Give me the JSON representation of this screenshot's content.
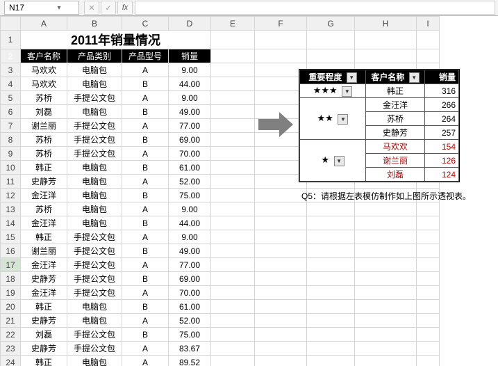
{
  "formula_bar": {
    "name_box": "N17",
    "cancel": "✕",
    "enter": "✓",
    "fx": "fx",
    "value": ""
  },
  "columns": [
    "A",
    "B",
    "C",
    "D",
    "E",
    "F",
    "G",
    "H",
    "I"
  ],
  "title": "2011年销量情况",
  "headers": [
    "客户名称",
    "产品类别",
    "产品型号",
    "销量"
  ],
  "rows": [
    [
      "马欢欢",
      "电脑包",
      "A",
      "9.00"
    ],
    [
      "马欢欢",
      "电脑包",
      "B",
      "44.00"
    ],
    [
      "苏桥",
      "手提公文包",
      "A",
      "9.00"
    ],
    [
      "刘磊",
      "电脑包",
      "B",
      "49.00"
    ],
    [
      "谢兰丽",
      "手提公文包",
      "A",
      "77.00"
    ],
    [
      "苏桥",
      "手提公文包",
      "B",
      "69.00"
    ],
    [
      "苏桥",
      "手提公文包",
      "A",
      "70.00"
    ],
    [
      "韩正",
      "电脑包",
      "B",
      "61.00"
    ],
    [
      "史静芳",
      "电脑包",
      "A",
      "52.00"
    ],
    [
      "金汪洋",
      "电脑包",
      "B",
      "75.00"
    ],
    [
      "苏桥",
      "电脑包",
      "A",
      "9.00"
    ],
    [
      "金汪洋",
      "电脑包",
      "B",
      "44.00"
    ],
    [
      "韩正",
      "手提公文包",
      "A",
      "9.00"
    ],
    [
      "谢兰丽",
      "手提公文包",
      "B",
      "49.00"
    ],
    [
      "金汪洋",
      "手提公文包",
      "A",
      "77.00"
    ],
    [
      "史静芳",
      "手提公文包",
      "B",
      "69.00"
    ],
    [
      "金汪洋",
      "手提公文包",
      "A",
      "70.00"
    ],
    [
      "韩正",
      "电脑包",
      "B",
      "61.00"
    ],
    [
      "史静芳",
      "电脑包",
      "A",
      "52.00"
    ],
    [
      "刘磊",
      "手提公文包",
      "B",
      "75.00"
    ],
    [
      "史静芳",
      "手提公文包",
      "A",
      "83.67"
    ],
    [
      "韩正",
      "电脑包",
      "A",
      "89.52"
    ]
  ],
  "pivot": {
    "headers": [
      "重要程度",
      "客户名称",
      "销量"
    ],
    "groups": [
      {
        "label": "★★★",
        "rows": [
          [
            "韩正",
            "316"
          ]
        ]
      },
      {
        "label": "★★",
        "rows": [
          [
            "金汪洋",
            "266"
          ],
          [
            "苏桥",
            "264"
          ],
          [
            "史静芳",
            "257"
          ]
        ]
      },
      {
        "label": "★",
        "rows": [
          [
            "马欢欢",
            "154"
          ],
          [
            "谢兰丽",
            "126"
          ],
          [
            "刘磊",
            "124"
          ]
        ],
        "red": true
      }
    ]
  },
  "q5": "Q5：请根据左表模仿制作如上图所示透视表。",
  "selected_row": 17,
  "chart_data": {
    "type": "table",
    "title": "2011年销量情况 — 透视表",
    "columns": [
      "重要程度",
      "客户名称",
      "销量"
    ],
    "rows": [
      [
        "★★★",
        "韩正",
        316
      ],
      [
        "★★",
        "金汪洋",
        266
      ],
      [
        "★★",
        "苏桥",
        264
      ],
      [
        "★★",
        "史静芳",
        257
      ],
      [
        "★",
        "马欢欢",
        154
      ],
      [
        "★",
        "谢兰丽",
        126
      ],
      [
        "★",
        "刘磊",
        124
      ]
    ]
  }
}
